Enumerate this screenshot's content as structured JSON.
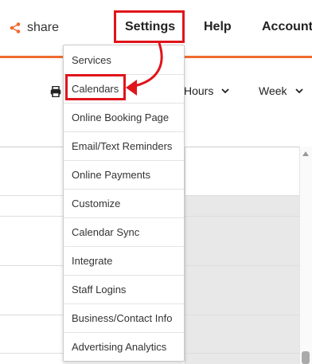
{
  "header": {
    "share_label": "share",
    "nav": {
      "settings": "Settings",
      "help": "Help",
      "account": "Account"
    },
    "accent_color": "#ef6b2f"
  },
  "toolbar": {
    "hours_label": "Hours",
    "week_label": "Week"
  },
  "settings_menu": {
    "items": [
      "Services",
      "Calendars",
      "Online Booking Page",
      "Email/Text Reminders",
      "Online Payments",
      "Customize",
      "Calendar Sync",
      "Integrate",
      "Staff Logins",
      "Business/Contact Info",
      "Advertising Analytics"
    ]
  },
  "annotation": {
    "highlight_color": "#e0141b"
  }
}
